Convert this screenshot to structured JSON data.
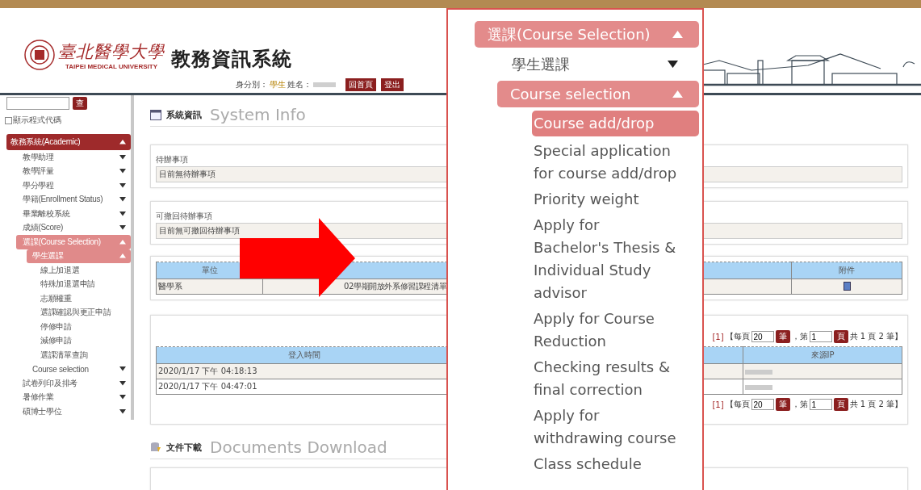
{
  "header": {
    "university_name": "臺北醫學大學",
    "university_name_en": "TAIPEI MEDICAL UNIVERSITY",
    "system_title": "教務資訊系統",
    "identity_label": "身分別：",
    "identity": "學生",
    "name_label": "姓名：",
    "buttons": [
      "回首頁",
      "登出"
    ]
  },
  "sidebar": {
    "search_button": "查",
    "show_code": {
      "label": "顯示程式代碼",
      "checked": false
    },
    "menu": [
      {
        "label": "教務系統(Academic)",
        "expanded": true,
        "children": [
          {
            "label": "教學助理",
            "expanded": false
          },
          {
            "label": "教學評量",
            "expanded": false
          },
          {
            "label": "學分學程",
            "expanded": false
          },
          {
            "label": "學籍(Enrollment Status)",
            "expanded": false
          },
          {
            "label": "畢業離校系統",
            "expanded": false
          },
          {
            "label": "成績(Score)",
            "expanded": false
          },
          {
            "label": "選課(Course Selection)",
            "expanded": true,
            "children": [
              {
                "label": "學生選課",
                "expanded": true,
                "children": [
                  {
                    "label": "線上加退選"
                  },
                  {
                    "label": "特殊加退選申請"
                  },
                  {
                    "label": "志願權重"
                  },
                  {
                    "label": "選課確認與更正申請"
                  },
                  {
                    "label": "停修申請"
                  },
                  {
                    "label": "減修申請"
                  },
                  {
                    "label": "選課清單查詢"
                  }
                ]
              },
              {
                "label": "Course selection",
                "expanded": false
              }
            ]
          },
          {
            "label": "試卷列印及排考",
            "expanded": false
          },
          {
            "label": "暑修作業",
            "expanded": false
          },
          {
            "label": "碩博士學位",
            "expanded": false
          }
        ]
      }
    ]
  },
  "system_info": {
    "title_zh": "系統資訊",
    "title_en": "System Info"
  },
  "todo": {
    "label": "待辦事項",
    "value": "目前無待辦事項"
  },
  "revocable": {
    "label": "可撤回待辦事項",
    "value": "目前無可撤回待辦事項"
  },
  "announcements": {
    "column_1": "單位",
    "column_3": "附件",
    "rows": [
      {
        "unit": "醫學系",
        "title": "02學期開放外系修習課程清單"
      }
    ]
  },
  "login_history": {
    "pagers": [
      {
        "page_link": "[1]",
        "open": "【每頁",
        "per_page": "20",
        "per_page_button": "筆",
        "page_label": "，第",
        "page": "1",
        "page_button": "頁",
        "summary": "共 1 頁 2 筆】"
      },
      {
        "page_link": "[1]",
        "open": "【每頁",
        "per_page": "20",
        "per_page_button": "筆",
        "page_label": "，第",
        "page": "1",
        "page_button": "頁",
        "summary": "共 1 頁 2 筆】"
      }
    ],
    "columns": [
      "登入時間",
      "來源IP"
    ],
    "rows": [
      {
        "time": "2020/1/17 下午 04:18:13"
      },
      {
        "time": "2020/1/17 下午 04:47:01"
      }
    ]
  },
  "documents": {
    "title_zh": "文件下載",
    "title_en": "Documents Download"
  },
  "zoomed_menu": [
    {
      "label": "選課(Course Selection)",
      "expanded": true,
      "children": [
        {
          "label": "學生選課",
          "expanded": false
        },
        {
          "label": "Course selection",
          "expanded": true,
          "children": [
            {
              "label": "Course add/drop",
              "selected": true
            },
            {
              "label": "Special application for course add/drop",
              "selected": false
            },
            {
              "label": "Priority weight",
              "selected": false
            },
            {
              "label": "Apply for Bachelor's Thesis & Individual Study advisor",
              "selected": false
            },
            {
              "label": "Apply for Course Reduction",
              "selected": false
            },
            {
              "label": "Checking results & final correction",
              "selected": false
            },
            {
              "label": "Apply for withdrawing course",
              "selected": false
            },
            {
              "label": "Class schedule",
              "selected": false
            }
          ]
        }
      ]
    }
  ]
}
